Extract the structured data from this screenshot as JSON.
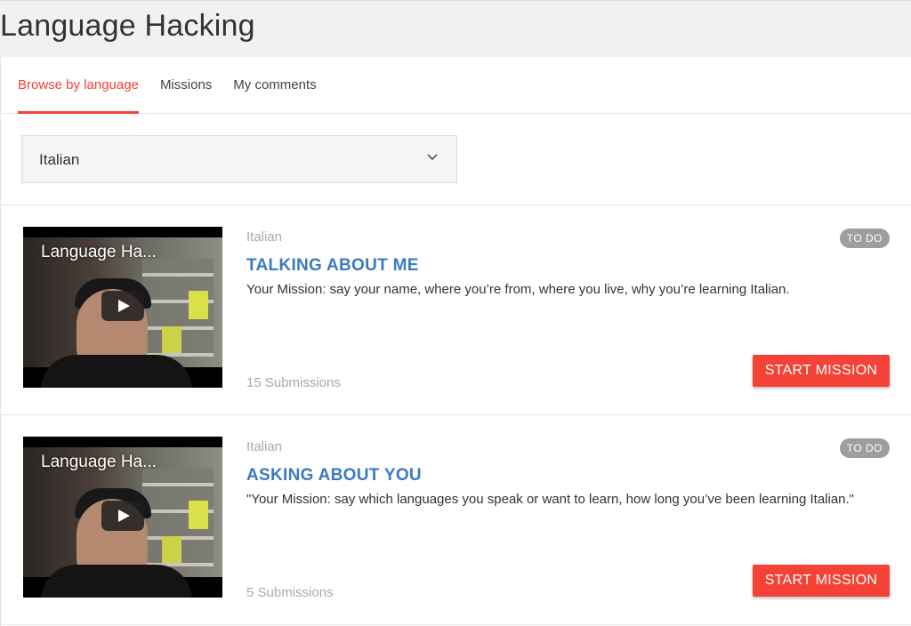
{
  "header": {
    "title": "Language Hacking"
  },
  "tabs": [
    {
      "label": "Browse by language",
      "active": true
    },
    {
      "label": "Missions",
      "active": false
    },
    {
      "label": "My comments",
      "active": false
    }
  ],
  "language_select": {
    "value": "Italian",
    "icon": "chevron-down-icon"
  },
  "colors": {
    "accent": "#f44336",
    "title": "#3a7bbf",
    "badge": "#9e9e9e"
  },
  "missions": [
    {
      "video_title": "Language Ha...",
      "language": "Italian",
      "title": "TALKING ABOUT ME",
      "description": "Your Mission: say your name, where you’re from, where you live, why you’re learning Italian.",
      "submissions": "15 Submissions",
      "status": "TO DO",
      "button": "START MISSION"
    },
    {
      "video_title": "Language Ha...",
      "language": "Italian",
      "title": "ASKING ABOUT YOU",
      "description": "\"Your Mission: say which languages you speak or want to learn, how long you’ve been learning Italian.\"",
      "submissions": "5 Submissions",
      "status": "TO DO",
      "button": "START MISSION"
    }
  ]
}
